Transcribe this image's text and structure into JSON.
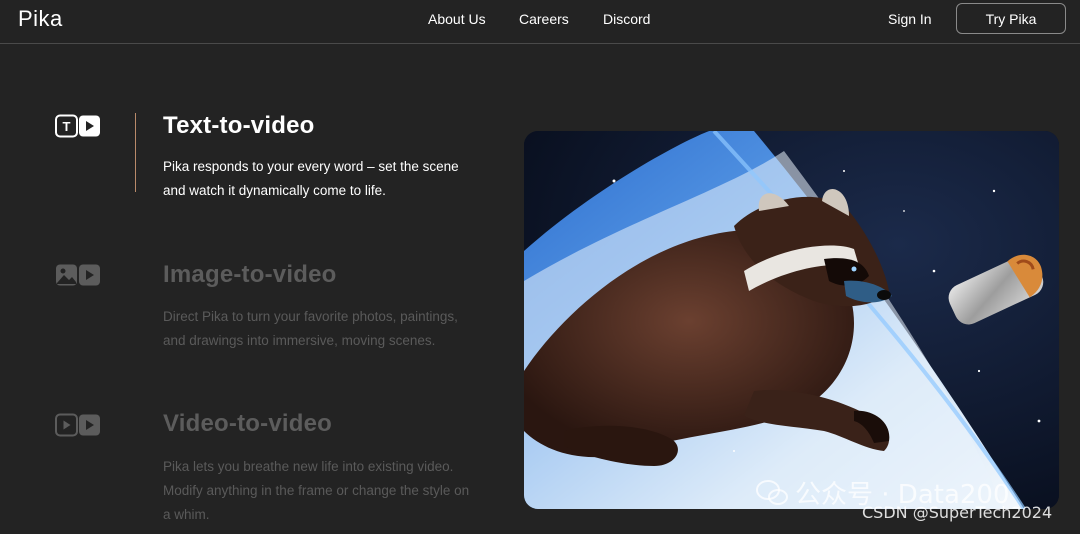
{
  "header": {
    "logo": "Pika",
    "nav": [
      {
        "label": "About Us"
      },
      {
        "label": "Careers"
      },
      {
        "label": "Discord"
      }
    ],
    "sign_in": "Sign In",
    "try_button": "Try Pika"
  },
  "features": [
    {
      "icon": "text-to-video-icon",
      "title": "Text-to-video",
      "description_line1": "Pika responds to your every word – set the scene",
      "description_line2": "and watch it dynamically come to life.",
      "active": true
    },
    {
      "icon": "image-to-video-icon",
      "title": "Image-to-video",
      "description_line1": "Direct Pika to turn your favorite photos, paintings,",
      "description_line2": "and drawings into immersive, moving scenes.",
      "active": false
    },
    {
      "icon": "video-to-video-icon",
      "title": "Video-to-video",
      "description_line1": "Pika lets you breathe new life into existing video.",
      "description_line2": "Modify anything in the frame or change the style on",
      "description_line3": "a whim.",
      "active": false
    }
  ],
  "media": {
    "alt": "raccoon-floating-in-space-image"
  },
  "watermarks": {
    "wechat": "公众号 · Data200",
    "csdn": "CSDN @SuperTech2024"
  },
  "colors": {
    "background": "#232323",
    "accent_line": "#b98a6a",
    "inactive_text": "#5c5c5c"
  }
}
